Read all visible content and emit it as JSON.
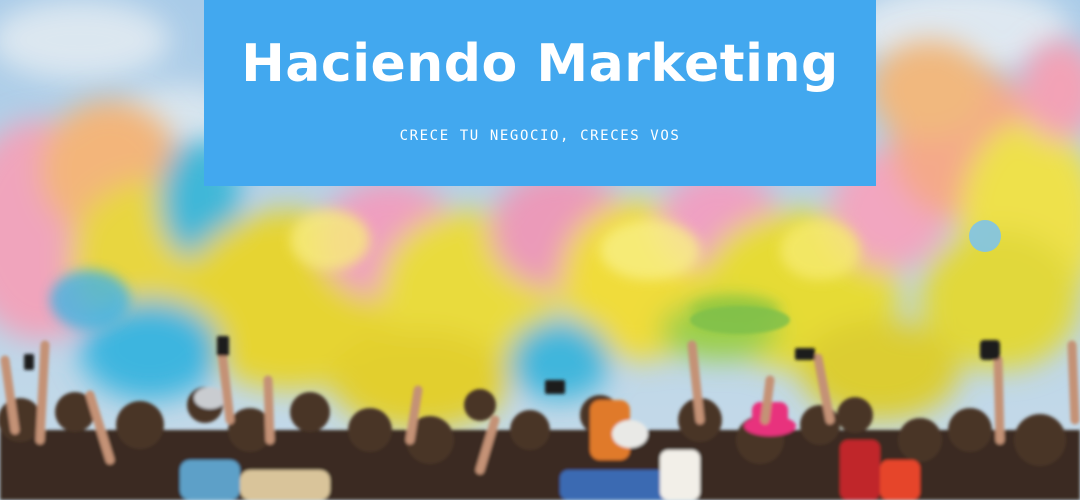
{
  "banner": {
    "title": "Haciendo Marketing",
    "subtitle": "CRECE TU NEGOCIO, CRECES VOS"
  },
  "colors": {
    "panel": "#42a8ef",
    "sky": "#9fc6e6",
    "powder_yellow": "#e6d83a",
    "powder_pink": "#ee9ab8",
    "powder_blue": "#3cb4e0",
    "crowd": "#3a2a22"
  },
  "photo": {
    "subject": "festival-crowd-color-powder"
  }
}
